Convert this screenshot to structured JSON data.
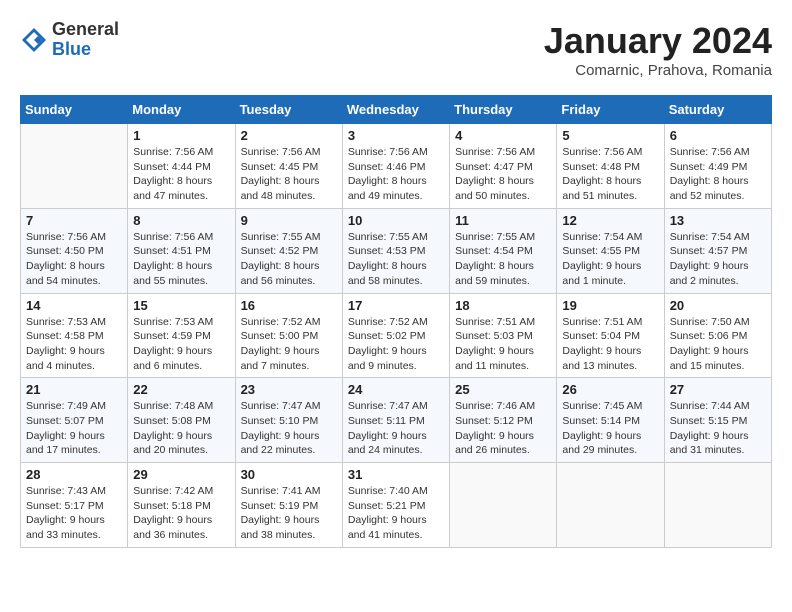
{
  "logo": {
    "general": "General",
    "blue": "Blue"
  },
  "title": "January 2024",
  "subtitle": "Comarnic, Prahova, Romania",
  "header_days": [
    "Sunday",
    "Monday",
    "Tuesday",
    "Wednesday",
    "Thursday",
    "Friday",
    "Saturday"
  ],
  "weeks": [
    [
      {
        "day": "",
        "info": ""
      },
      {
        "day": "1",
        "info": "Sunrise: 7:56 AM\nSunset: 4:44 PM\nDaylight: 8 hours\nand 47 minutes."
      },
      {
        "day": "2",
        "info": "Sunrise: 7:56 AM\nSunset: 4:45 PM\nDaylight: 8 hours\nand 48 minutes."
      },
      {
        "day": "3",
        "info": "Sunrise: 7:56 AM\nSunset: 4:46 PM\nDaylight: 8 hours\nand 49 minutes."
      },
      {
        "day": "4",
        "info": "Sunrise: 7:56 AM\nSunset: 4:47 PM\nDaylight: 8 hours\nand 50 minutes."
      },
      {
        "day": "5",
        "info": "Sunrise: 7:56 AM\nSunset: 4:48 PM\nDaylight: 8 hours\nand 51 minutes."
      },
      {
        "day": "6",
        "info": "Sunrise: 7:56 AM\nSunset: 4:49 PM\nDaylight: 8 hours\nand 52 minutes."
      }
    ],
    [
      {
        "day": "7",
        "info": "Sunrise: 7:56 AM\nSunset: 4:50 PM\nDaylight: 8 hours\nand 54 minutes."
      },
      {
        "day": "8",
        "info": "Sunrise: 7:56 AM\nSunset: 4:51 PM\nDaylight: 8 hours\nand 55 minutes."
      },
      {
        "day": "9",
        "info": "Sunrise: 7:55 AM\nSunset: 4:52 PM\nDaylight: 8 hours\nand 56 minutes."
      },
      {
        "day": "10",
        "info": "Sunrise: 7:55 AM\nSunset: 4:53 PM\nDaylight: 8 hours\nand 58 minutes."
      },
      {
        "day": "11",
        "info": "Sunrise: 7:55 AM\nSunset: 4:54 PM\nDaylight: 8 hours\nand 59 minutes."
      },
      {
        "day": "12",
        "info": "Sunrise: 7:54 AM\nSunset: 4:55 PM\nDaylight: 9 hours\nand 1 minute."
      },
      {
        "day": "13",
        "info": "Sunrise: 7:54 AM\nSunset: 4:57 PM\nDaylight: 9 hours\nand 2 minutes."
      }
    ],
    [
      {
        "day": "14",
        "info": "Sunrise: 7:53 AM\nSunset: 4:58 PM\nDaylight: 9 hours\nand 4 minutes."
      },
      {
        "day": "15",
        "info": "Sunrise: 7:53 AM\nSunset: 4:59 PM\nDaylight: 9 hours\nand 6 minutes."
      },
      {
        "day": "16",
        "info": "Sunrise: 7:52 AM\nSunset: 5:00 PM\nDaylight: 9 hours\nand 7 minutes."
      },
      {
        "day": "17",
        "info": "Sunrise: 7:52 AM\nSunset: 5:02 PM\nDaylight: 9 hours\nand 9 minutes."
      },
      {
        "day": "18",
        "info": "Sunrise: 7:51 AM\nSunset: 5:03 PM\nDaylight: 9 hours\nand 11 minutes."
      },
      {
        "day": "19",
        "info": "Sunrise: 7:51 AM\nSunset: 5:04 PM\nDaylight: 9 hours\nand 13 minutes."
      },
      {
        "day": "20",
        "info": "Sunrise: 7:50 AM\nSunset: 5:06 PM\nDaylight: 9 hours\nand 15 minutes."
      }
    ],
    [
      {
        "day": "21",
        "info": "Sunrise: 7:49 AM\nSunset: 5:07 PM\nDaylight: 9 hours\nand 17 minutes."
      },
      {
        "day": "22",
        "info": "Sunrise: 7:48 AM\nSunset: 5:08 PM\nDaylight: 9 hours\nand 20 minutes."
      },
      {
        "day": "23",
        "info": "Sunrise: 7:47 AM\nSunset: 5:10 PM\nDaylight: 9 hours\nand 22 minutes."
      },
      {
        "day": "24",
        "info": "Sunrise: 7:47 AM\nSunset: 5:11 PM\nDaylight: 9 hours\nand 24 minutes."
      },
      {
        "day": "25",
        "info": "Sunrise: 7:46 AM\nSunset: 5:12 PM\nDaylight: 9 hours\nand 26 minutes."
      },
      {
        "day": "26",
        "info": "Sunrise: 7:45 AM\nSunset: 5:14 PM\nDaylight: 9 hours\nand 29 minutes."
      },
      {
        "day": "27",
        "info": "Sunrise: 7:44 AM\nSunset: 5:15 PM\nDaylight: 9 hours\nand 31 minutes."
      }
    ],
    [
      {
        "day": "28",
        "info": "Sunrise: 7:43 AM\nSunset: 5:17 PM\nDaylight: 9 hours\nand 33 minutes."
      },
      {
        "day": "29",
        "info": "Sunrise: 7:42 AM\nSunset: 5:18 PM\nDaylight: 9 hours\nand 36 minutes."
      },
      {
        "day": "30",
        "info": "Sunrise: 7:41 AM\nSunset: 5:19 PM\nDaylight: 9 hours\nand 38 minutes."
      },
      {
        "day": "31",
        "info": "Sunrise: 7:40 AM\nSunset: 5:21 PM\nDaylight: 9 hours\nand 41 minutes."
      },
      {
        "day": "",
        "info": ""
      },
      {
        "day": "",
        "info": ""
      },
      {
        "day": "",
        "info": ""
      }
    ]
  ]
}
